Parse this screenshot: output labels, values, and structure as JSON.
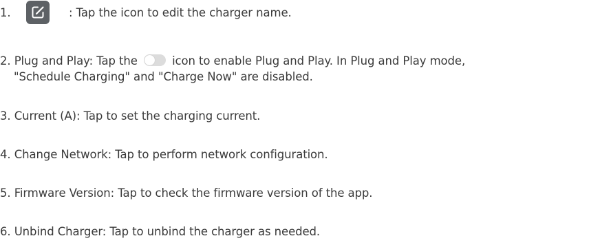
{
  "items": [
    {
      "number": "1.",
      "icon": "edit-icon",
      "text": ": Tap the icon to edit the charger name."
    },
    {
      "text_before_icon": "2. Plug and Play: Tap the",
      "icon": "toggle-switch-icon",
      "text_after_icon": "icon to enable Plug and Play. In Plug and Play mode,",
      "continuation": "\"Schedule Charging\" and \"Charge Now\" are disabled."
    },
    {
      "text": "3. Current (A): Tap to set the charging current."
    },
    {
      "text": "4. Change Network: Tap to perform network configuration."
    },
    {
      "text": "5. Firmware Version: Tap to check the firmware version of the app."
    },
    {
      "text": "6. Unbind Charger: Tap to unbind the charger as needed."
    }
  ],
  "colors": {
    "text": "#3a3a3a",
    "edit_icon_bg": "#5d6165",
    "toggle_track": "#dcdcdc"
  }
}
